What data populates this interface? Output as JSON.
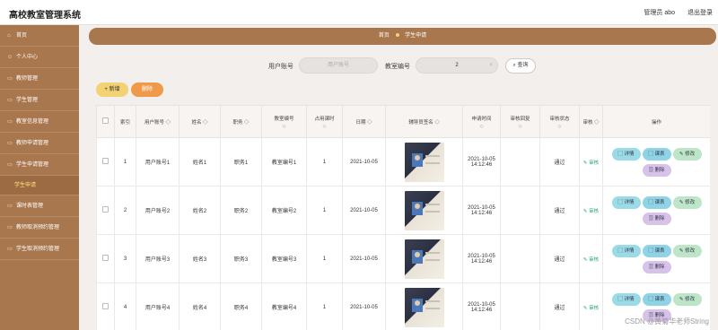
{
  "app": {
    "title": "高校教室管理系统",
    "user_label": "管理员 abo",
    "logout_label": "退出登录"
  },
  "sidebar": {
    "items": [
      {
        "label": "首页",
        "icon": "home-icon"
      },
      {
        "label": "个人中心",
        "icon": "user-icon"
      },
      {
        "label": "教师管理",
        "icon": "folder-icon"
      },
      {
        "label": "学生管理",
        "icon": "folder-icon"
      },
      {
        "label": "教室信息管理",
        "icon": "folder-icon"
      },
      {
        "label": "教师申请管理",
        "icon": "folder-icon"
      },
      {
        "label": "学生申请管理",
        "icon": "folder-icon"
      },
      {
        "label": "学生申请",
        "icon": "",
        "sub": true
      },
      {
        "label": "课时表管理",
        "icon": "folder-icon"
      },
      {
        "label": "教师取消预约管理",
        "icon": "folder-icon"
      },
      {
        "label": "学生取消预约管理",
        "icon": "folder-icon"
      }
    ]
  },
  "breadcrumb": {
    "home": "首页",
    "current": "学生申请"
  },
  "search": {
    "user_label": "用户账号",
    "user_placeholder": "用户账号",
    "room_label": "教室编号",
    "room_value": "2",
    "room_clear": "×",
    "button_label": "查询"
  },
  "actions": {
    "add_label": "+ 新增",
    "delete_label": "删除"
  },
  "table": {
    "headers": [
      "索引",
      "用户账号",
      "姓名",
      "职务",
      "教室编号",
      "占用课时",
      "日期",
      "辅导员签名",
      "申请时间",
      "审核回复",
      "审核状态",
      "审核",
      "操作"
    ],
    "sort_mark": "◇",
    "rows": [
      {
        "index": "1",
        "user": "用户账号1",
        "name": "姓名1",
        "duty": "职务1",
        "room": "教室编号1",
        "hours": "1",
        "date": "2021-10-05",
        "apply_date": "2021-10-05",
        "apply_time": "14:12:46",
        "reply": "",
        "status": "通过",
        "audit": "审核"
      },
      {
        "index": "2",
        "user": "用户账号2",
        "name": "姓名2",
        "duty": "职务2",
        "room": "教室编号2",
        "hours": "1",
        "date": "2021-10-05",
        "apply_date": "2021-10-05",
        "apply_time": "14:12:46",
        "reply": "",
        "status": "通过",
        "audit": "审核"
      },
      {
        "index": "3",
        "user": "用户账号3",
        "name": "姓名3",
        "duty": "职务3",
        "room": "教室编号3",
        "hours": "1",
        "date": "2021-10-05",
        "apply_date": "2021-10-05",
        "apply_time": "14:12:46",
        "reply": "",
        "status": "通过",
        "audit": "审核"
      },
      {
        "index": "4",
        "user": "用户账号4",
        "name": "姓名4",
        "duty": "职务4",
        "room": "教室编号4",
        "hours": "1",
        "date": "2021-10-05",
        "apply_date": "2021-10-05",
        "apply_time": "14:12:46",
        "reply": "",
        "status": "通过",
        "audit": "审核"
      }
    ],
    "ops": {
      "detail": "详情",
      "course": "课表",
      "edit": "修改",
      "delete": "删除"
    }
  },
  "watermark": "CSDN @黄菊华老师String"
}
